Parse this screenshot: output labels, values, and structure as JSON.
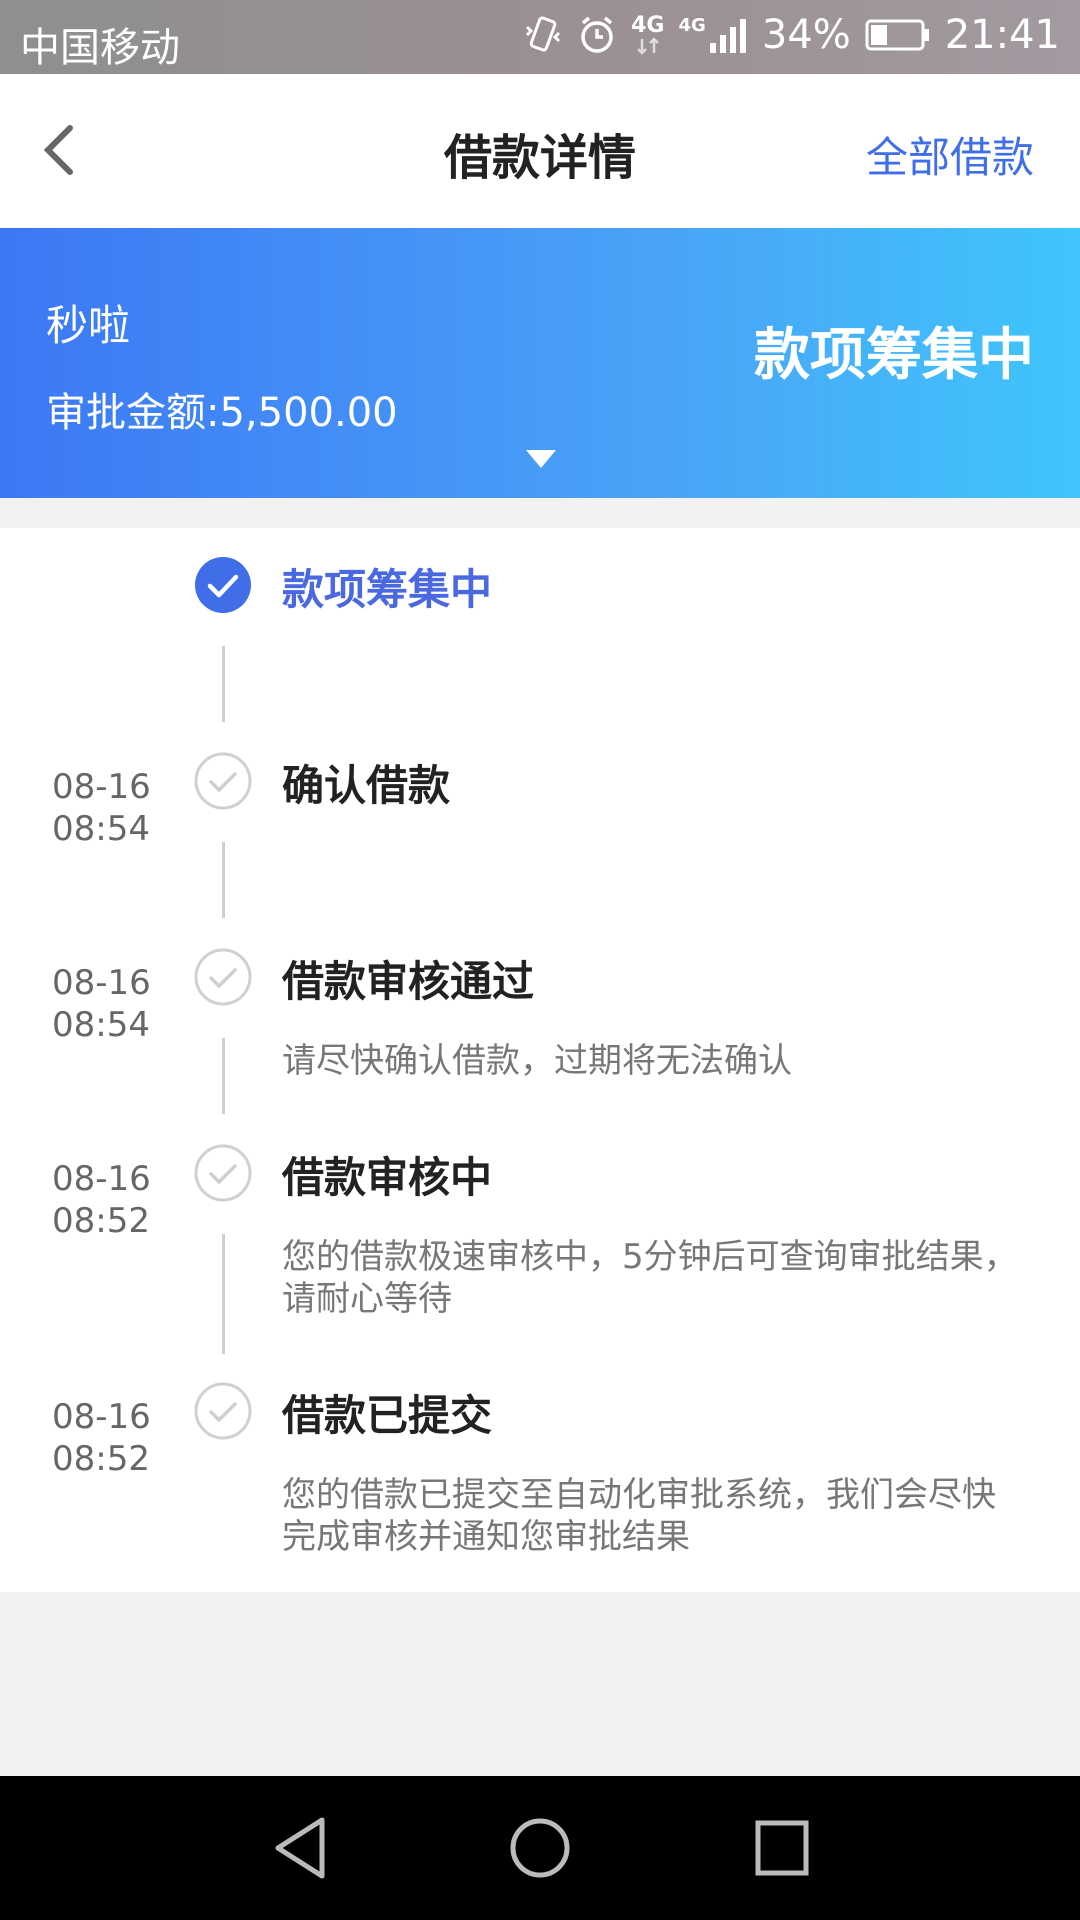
{
  "status_bar": {
    "carrier": "中国移动",
    "net1": "4G",
    "net2": "4G",
    "battery": "34%",
    "time": "21:41"
  },
  "nav": {
    "title": "借款详情",
    "action": "全部借款"
  },
  "banner": {
    "name": "秒啦",
    "amount": "审批金额:5,500.00",
    "status": "款项筹集中"
  },
  "steps": [
    {
      "time_date": "",
      "time_clock": "",
      "title": "款项筹集中",
      "desc": "",
      "active": true
    },
    {
      "time_date": "08-16",
      "time_clock": "08:54",
      "title": "确认借款",
      "desc": "",
      "active": false
    },
    {
      "time_date": "08-16",
      "time_clock": "08:54",
      "title": "借款审核通过",
      "desc": "请尽快确认借款，过期将无法确认",
      "active": false
    },
    {
      "time_date": "08-16",
      "time_clock": "08:52",
      "title": "借款审核中",
      "desc": "您的借款极速审核中，5分钟后可查询审批结果，请耐心等待",
      "active": false
    },
    {
      "time_date": "08-16",
      "time_clock": "08:52",
      "title": "借款已提交",
      "desc": "您的借款已提交至自动化审批系统，我们会尽快完成审核并通知您审批结果",
      "active": false
    }
  ],
  "colors": {
    "accent": "#4a68e0",
    "banner_start": "#3c78f5",
    "banner_end": "#3fc5fb"
  }
}
